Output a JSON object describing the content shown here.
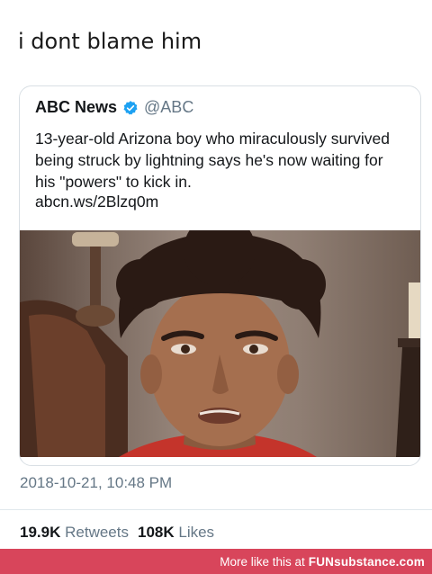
{
  "caption": "i dont blame him",
  "tweet": {
    "author": "ABC News",
    "handle": "@ABC",
    "verified_icon": "verified-badge-icon",
    "text": "13-year-old Arizona boy who miraculously survived being struck by lightning says he's now waiting for his \"powers\" to kick in.",
    "link": "abcn.ws/2Blzq0m",
    "timestamp": "2018-10-21, 10:48 PM",
    "retweets_count": "19.9K",
    "retweets_label": "Retweets",
    "likes_count": "108K",
    "likes_label": "Likes"
  },
  "footer": {
    "text": "More like this at",
    "brand": "FUNsubstance.com"
  },
  "colors": {
    "verified": "#1da1f2",
    "footer_bg": "#d8455b",
    "secondary_text": "#657786"
  }
}
